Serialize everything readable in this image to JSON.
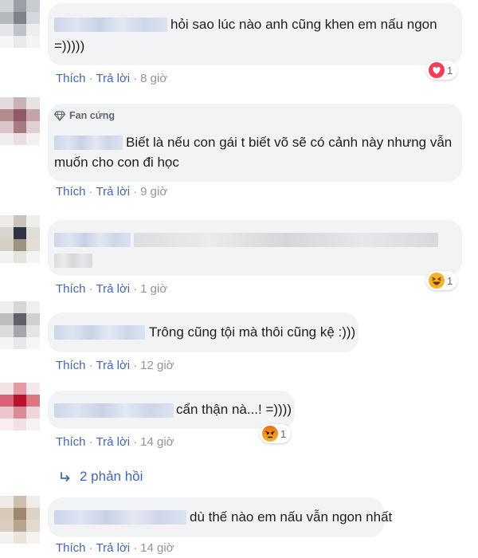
{
  "comments": [
    {
      "text_lines": [
        "hỏi sao lúc nào anh cũng khen em nấu ngon",
        "=)))))"
      ],
      "actions": {
        "like": "Thích",
        "reply": "Trả lời",
        "time": "8 giờ"
      },
      "reaction": {
        "icon": "love-icon",
        "count": "1"
      }
    },
    {
      "badge": "Fan cứng",
      "text_lines": [
        "Biết là nếu con gái t biết võ sẽ có cảnh này nhưng vẫn",
        "muốn cho con đi học"
      ],
      "actions": {
        "like": "Thích",
        "reply": "Trả lời",
        "time": "9 giờ"
      }
    },
    {
      "text_lines": [],
      "actions": {
        "like": "Thích",
        "reply": "Trả lời",
        "time": "1 giờ"
      },
      "reaction": {
        "icon": "haha-icon",
        "count": "1"
      }
    },
    {
      "text_lines": [
        "Trông cũng tội mà thôi cũng kệ :)))"
      ],
      "actions": {
        "like": "Thích",
        "reply": "Trả lời",
        "time": "12 giờ"
      }
    },
    {
      "text_lines": [
        "cẩn thận nà...! =))))"
      ],
      "actions": {
        "like": "Thích",
        "reply": "Trả lời",
        "time": "14 giờ"
      },
      "reaction": {
        "icon": "angry-icon",
        "count": "1"
      }
    },
    {
      "text_lines": [
        "dù thế nào em nấu vẫn ngon nhất"
      ],
      "actions": {
        "like": "Thích",
        "reply": "Trả lời",
        "time": "14 giờ"
      }
    }
  ],
  "replies_link": {
    "icon": "reply-arrow-icon",
    "label": "2 phản hồi"
  },
  "colors": {
    "link": "#4267b2",
    "bubble": "#f2f3f5",
    "meta": "#90949c",
    "love": "#f33e58",
    "haha": "#f7b125",
    "angry": "#e9710f"
  }
}
